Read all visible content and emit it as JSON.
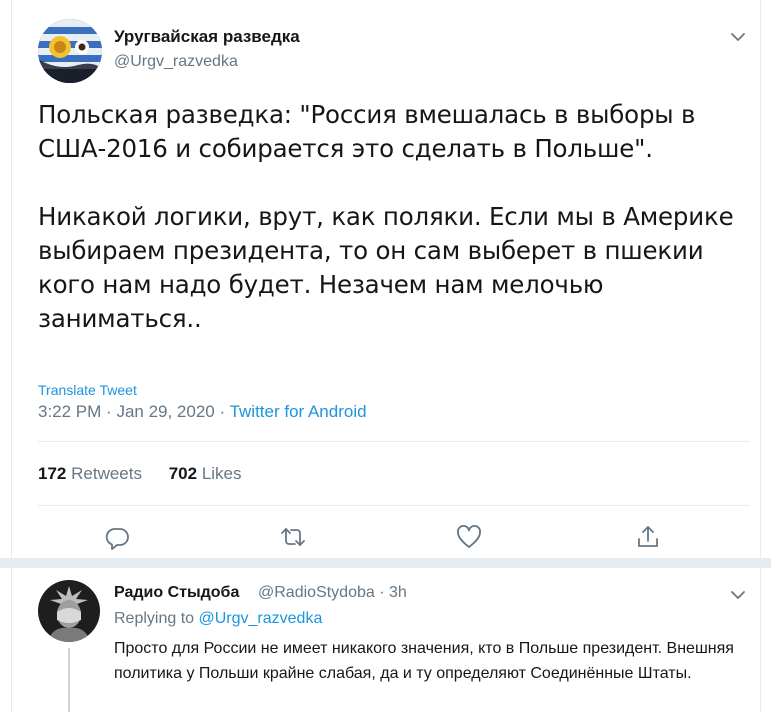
{
  "tweet": {
    "display_name": "Уругвайская разведка",
    "handle": "@Urgv_razvedka",
    "text": "Польская разведка: \"Россия вмешалась в выборы в США-2016 и собирается это сделать в Польше\".\n\nНикакой логики, врут, как поляки. Если мы в Америке выбираем президента, то он сам выберет в пшекии кого нам надо будет. Незачем нам мелочью заниматься..",
    "translate_label": "Translate Tweet",
    "time": "3:22 PM",
    "date": "Jan 29, 2020",
    "source": "Twitter for Android",
    "retweets_count": "172",
    "retweets_label": "Retweets",
    "likes_count": "702",
    "likes_label": "Likes"
  },
  "actions": [
    {
      "icon": "reply-icon"
    },
    {
      "icon": "retweet-icon"
    },
    {
      "icon": "like-icon"
    },
    {
      "icon": "share-icon"
    }
  ],
  "reply": {
    "display_name": "Радио Стыдоба",
    "handle": "@RadioStydoba",
    "time": "3h",
    "replying_to_label": "Replying to",
    "replying_to_handle": "@Urgv_razvedka",
    "text": "Просто для России не имеет никакого значения, кто в Польше президент. Внешняя политика у Польши крайне слабая, да и ту определяют Соединённые Штаты."
  },
  "colors": {
    "link": "#1b95e0",
    "secondary_text": "#657786",
    "primary_text": "#14171a",
    "divider": "#e6ecf0"
  }
}
